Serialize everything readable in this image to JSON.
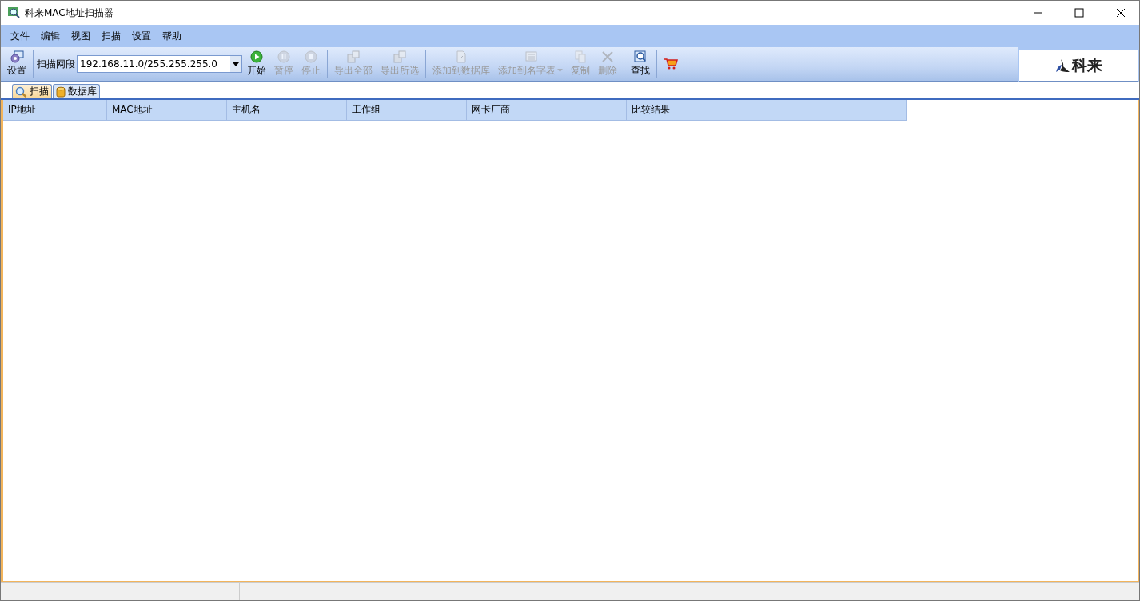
{
  "window": {
    "title": "科来MAC地址扫描器"
  },
  "menu": [
    "文件",
    "编辑",
    "视图",
    "扫描",
    "设置",
    "帮助"
  ],
  "toolbar": {
    "settings": {
      "label": "设置",
      "disabled": false
    },
    "range_label": "扫描网段",
    "range_value": "192.168.11.0/255.255.255.0",
    "groups": [
      [
        {
          "kind": "play",
          "label": "开始",
          "disabled": false
        },
        {
          "kind": "pause",
          "label": "暂停",
          "disabled": true
        },
        {
          "kind": "stop",
          "label": "停止",
          "disabled": true
        }
      ],
      [
        {
          "kind": "export",
          "label": "导出全部",
          "disabled": true
        },
        {
          "kind": "export",
          "label": "导出所选",
          "disabled": true
        }
      ],
      [
        {
          "kind": "doc",
          "label": "添加到数据库",
          "disabled": true
        },
        {
          "kind": "list",
          "label": "添加到名字表",
          "disabled": true,
          "dropdown": true
        },
        {
          "kind": "copy",
          "label": "复制",
          "disabled": true
        },
        {
          "kind": "delete",
          "label": "删除",
          "disabled": true
        }
      ],
      [
        {
          "kind": "find",
          "label": "查找",
          "disabled": false
        }
      ],
      [
        {
          "kind": "cart",
          "disabled": false
        }
      ]
    ]
  },
  "logo": "科来",
  "tabs": [
    {
      "label": "扫描",
      "selected": true,
      "kind": "search"
    },
    {
      "label": "数据库",
      "selected": false,
      "kind": "db"
    }
  ],
  "table": {
    "columns": [
      "IP地址",
      "MAC地址",
      "主机名",
      "工作组",
      "网卡厂商",
      "比较结果"
    ]
  }
}
